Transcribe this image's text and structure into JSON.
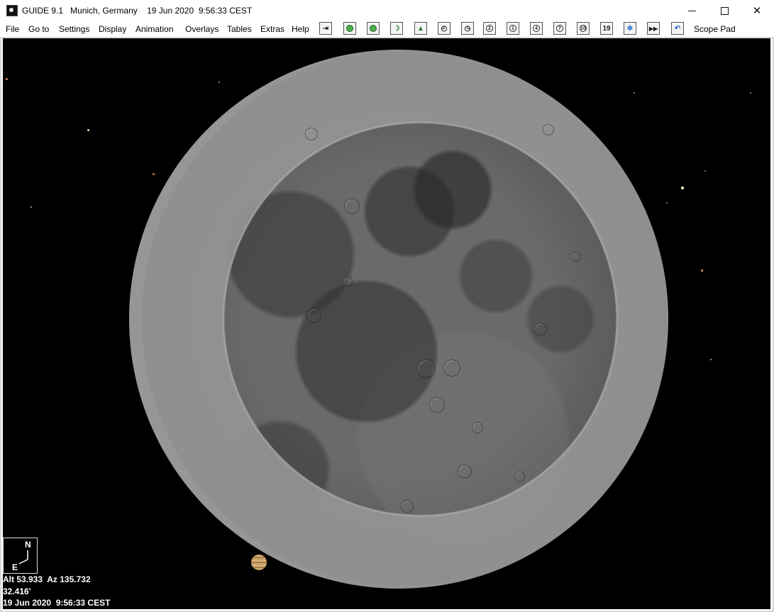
{
  "window": {
    "app_title": "GUIDE 9.1",
    "location": "Munich, Germany",
    "datetime": "19 Jun 2020  9:56:33 CEST",
    "controls": {
      "minimize_icon": "minimize-icon",
      "maximize_icon": "maximize-icon",
      "close_icon": "close-icon",
      "close_glyph": "✕"
    }
  },
  "menu": [
    {
      "label": "File"
    },
    {
      "label": "Go to"
    },
    {
      "label": "Settings"
    },
    {
      "label": "Display"
    },
    {
      "label": "Animation"
    },
    {
      "label": "Overlays"
    },
    {
      "label": "Tables"
    },
    {
      "label": "Extras"
    },
    {
      "label": "Help"
    }
  ],
  "toolbar": {
    "tools": [
      {
        "icon": "arrow-target-icon",
        "glyph": "⇥"
      },
      {
        "icon": "planet-icon",
        "glyph": "●"
      },
      {
        "icon": "target-circle-icon",
        "glyph": "◉"
      },
      {
        "icon": "moon-icon",
        "glyph": "☽"
      },
      {
        "icon": "landscape-icon",
        "glyph": "▲"
      },
      {
        "icon": "clock-1-icon",
        "glyph": "◴"
      },
      {
        "icon": "clock-2-icon",
        "glyph": "◷"
      },
      {
        "icon": "zoom-2-icon",
        "glyph": "2"
      },
      {
        "icon": "zoom-1-icon",
        "glyph": "1"
      },
      {
        "icon": "zoom-4-icon",
        "glyph": "4"
      },
      {
        "icon": "zoom-7-icon",
        "glyph": "7"
      },
      {
        "icon": "zoom-10-icon",
        "glyph": "10"
      },
      {
        "icon": "level-19-icon",
        "glyph": "19"
      },
      {
        "icon": "star-sparkle-icon",
        "glyph": "✲"
      },
      {
        "icon": "fast-forward-icon",
        "glyph": "▶▶"
      },
      {
        "icon": "undo-icon",
        "glyph": "↶"
      }
    ],
    "scope_pad_label": "Scope Pad"
  },
  "compass": {
    "north": "N",
    "east": "E"
  },
  "status": {
    "alt_az": "Alt 53.933  Az 135.732",
    "field": "32.416'",
    "datetime": "19 Jun 2020  9:56:33 CEST"
  }
}
